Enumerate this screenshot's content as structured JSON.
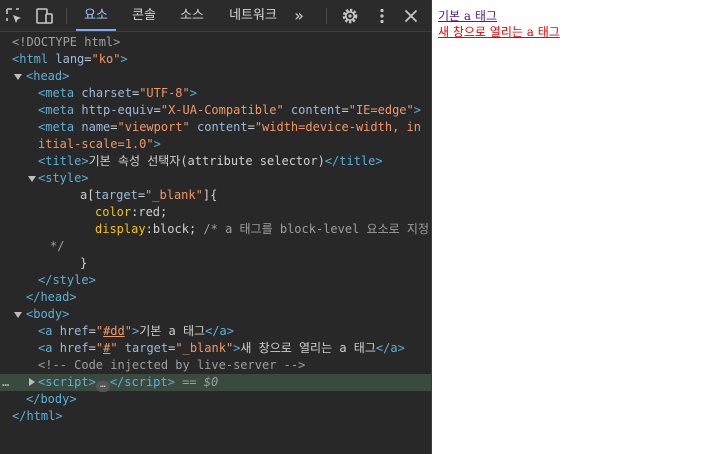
{
  "toolbar": {
    "tabs": [
      {
        "label": "요소",
        "active": true
      },
      {
        "label": "콘솔",
        "active": false
      },
      {
        "label": "소스",
        "active": false
      },
      {
        "label": "네트워크",
        "active": false
      }
    ],
    "more_tabs_label": "»",
    "icons": [
      "inspect-icon",
      "device-toggle-icon",
      "settings-gear-icon",
      "kebab-menu-icon",
      "close-icon"
    ]
  },
  "code": {
    "doctype": "<!DOCTYPE html>",
    "html_open_tag": "html",
    "html_lang_attr": "lang",
    "html_lang_val": "\"ko\"",
    "head_tag": "head",
    "meta": "meta",
    "charset_attr": "charset",
    "charset_val": "\"UTF-8\"",
    "http_equiv_attr": "http-equiv",
    "http_equiv_val": "\"X-UA-Compatible\"",
    "content_attr": "content",
    "content_val_ie": "\"IE=edge\"",
    "name_attr": "name",
    "name_val": "\"viewport\"",
    "content_val_vp_1": "\"width=device-width, in",
    "content_val_vp_2": "itial-scale=1.0\"",
    "title_tag": "title",
    "title_text": "기본 속성 선택자(attribute selector)",
    "style_tag": "style",
    "css_selector_elem": "a[",
    "css_selector_attr": "target",
    "css_selector_eq": "=",
    "css_selector_val": "\"_blank\"",
    "css_selector_close": "]{",
    "css_prop_color": "color",
    "css_val_color": "red",
    "css_prop_display": "display",
    "css_val_display": "block",
    "css_comment": "/* a 태그를 block-level 요소로 지정",
    "css_comment_end": "*/",
    "css_brace_close": "}",
    "body_tag": "body",
    "a_tag": "a",
    "href_attr": "href",
    "href_val_1": "\"#dd\"",
    "href_val_1_link": "#dd",
    "a1_text": "기본 a 태그",
    "href_val_2_link": "#",
    "target_attr": "target",
    "target_val": "\"_blank\"",
    "a2_text": "새 창으로 열리는 a 태그",
    "live_server_comment": "<!-- Code injected by live-server -->",
    "script_tag": "script",
    "selected_marker": "== $0",
    "ellipsis": "…"
  },
  "viewport": {
    "link1": "기본 a 태그",
    "link2": "새 창으로 열리는 a 태그"
  }
}
